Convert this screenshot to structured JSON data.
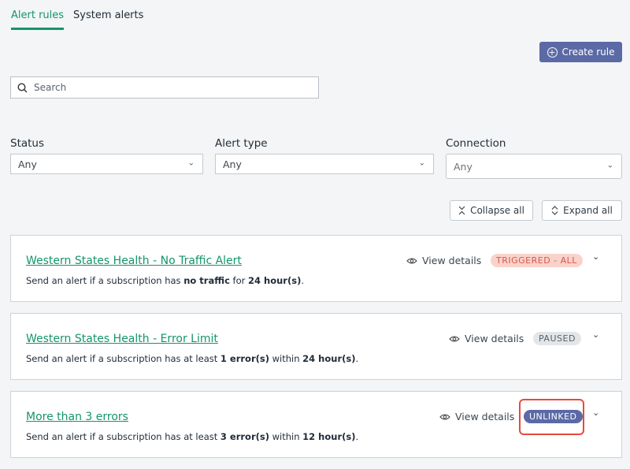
{
  "tabs": {
    "alert_rules": "Alert rules",
    "system_alerts": "System alerts"
  },
  "create_rule": "Create rule",
  "search": {
    "placeholder": "Search"
  },
  "filters": {
    "status": {
      "label": "Status",
      "value": "Any"
    },
    "alert_type": {
      "label": "Alert type",
      "value": "Any"
    },
    "connection": {
      "label": "Connection",
      "value": "Any"
    }
  },
  "toolbar": {
    "collapse_all": "Collapse all",
    "expand_all": "Expand all"
  },
  "rules": [
    {
      "title": "Western States Health - No Traffic Alert",
      "desc_pre": "Send an alert if a subscription has ",
      "desc_b1": "no traffic",
      "desc_mid": " for ",
      "desc_b2": "24 hour(s)",
      "desc_post": ".",
      "view": "View details",
      "status": "TRIGGERED - ALL"
    },
    {
      "title": "Western States Health - Error Limit",
      "desc_pre": "Send an alert if a subscription has at least ",
      "desc_b1": "1 error(s)",
      "desc_mid": " within ",
      "desc_b2": "24 hour(s)",
      "desc_post": ".",
      "view": "View details",
      "status": "PAUSED"
    },
    {
      "title": "More than 3 errors",
      "desc_pre": "Send an alert if a subscription has at least ",
      "desc_b1": "3 error(s)",
      "desc_mid": " within ",
      "desc_b2": "12 hour(s)",
      "desc_post": ".",
      "view": "View details",
      "status": "UNLINKED"
    }
  ],
  "colors": {
    "accent": "#14956b",
    "primary_button": "#5b6aa6",
    "highlight": "#e64a3b"
  }
}
